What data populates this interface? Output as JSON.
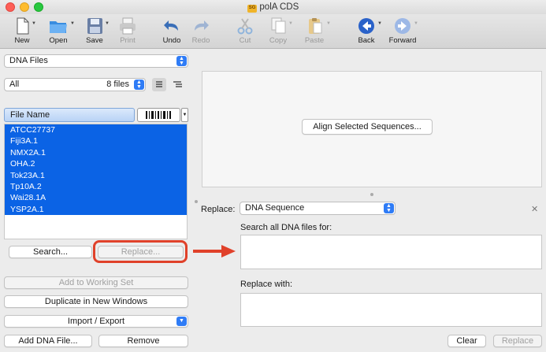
{
  "window": {
    "title": "polA CDS",
    "doc_badge": "SG"
  },
  "toolbar": {
    "items": [
      {
        "label": "New",
        "icon": "new-document-icon",
        "enabled": true
      },
      {
        "label": "Open",
        "icon": "open-folder-icon",
        "enabled": true
      },
      {
        "label": "Save",
        "icon": "save-disk-icon",
        "enabled": true
      },
      {
        "label": "Print",
        "icon": "printer-icon",
        "enabled": false
      },
      {
        "label": "Undo",
        "icon": "undo-arrow-icon",
        "enabled": true
      },
      {
        "label": "Redo",
        "icon": "redo-arrow-icon",
        "enabled": false
      },
      {
        "label": "Cut",
        "icon": "scissors-icon",
        "enabled": false
      },
      {
        "label": "Copy",
        "icon": "copy-icon",
        "enabled": false
      },
      {
        "label": "Paste",
        "icon": "paste-clipboard-icon",
        "enabled": false
      },
      {
        "label": "Back",
        "icon": "back-arrow-icon",
        "enabled": true
      },
      {
        "label": "Forward",
        "icon": "forward-arrow-icon",
        "enabled": false
      }
    ]
  },
  "left": {
    "source_select": "DNA Files",
    "filter_select": "All",
    "file_count": "8 files",
    "column_header": "File Name",
    "files": [
      "ATCC27737",
      "Fiji3A.1",
      "NMX2A.1",
      "OHA.2",
      "Tok23A.1",
      "Tp10A.2",
      "Wai28.1A",
      "YSP2A.1"
    ],
    "search_button": "Search...",
    "replace_button": "Replace...",
    "add_working_set": "Add to Working Set",
    "duplicate": "Duplicate in New Windows",
    "import_export": "Import / Export",
    "add_dna_file": "Add DNA File...",
    "remove": "Remove"
  },
  "right": {
    "align_button": "Align Selected Sequences...",
    "replace_label": "Replace:",
    "replace_type": "DNA Sequence",
    "search_label": "Search all DNA files for:",
    "search_value": "",
    "replace_with_label": "Replace with:",
    "replace_with_value": "",
    "clear": "Clear",
    "replace": "Replace"
  },
  "colors": {
    "accent": "#0b63e5",
    "highlight": "#e0412a"
  }
}
